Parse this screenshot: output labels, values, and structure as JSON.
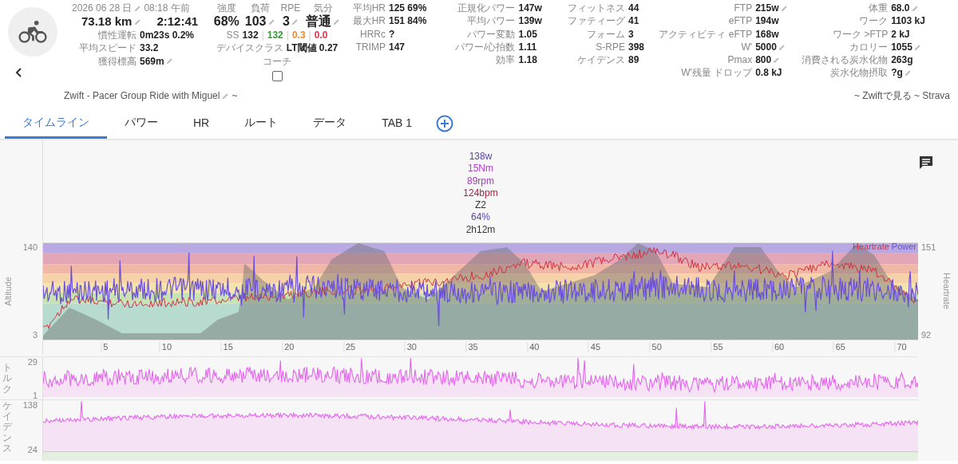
{
  "header": {
    "date": "2026 06 28 日",
    "time": "08:18 午前",
    "distance": "73.18 km",
    "duration": "2:12:41",
    "rows": [
      {
        "label": "慣性運転",
        "value": "0m23s 0.2%",
        "editable": false
      },
      {
        "label": "平均スピード",
        "value": "33.2",
        "editable": false
      },
      {
        "label": "獲得標高",
        "value": "569m",
        "editable": true
      }
    ],
    "ratings": [
      {
        "label": "強度",
        "value": "68%",
        "editable": false
      },
      {
        "label": "負荷",
        "value": "103",
        "editable": true
      },
      {
        "label": "RPE",
        "value": "3",
        "editable": true
      },
      {
        "label": "気分",
        "value": "普通",
        "editable": true
      }
    ],
    "ss": {
      "label": "SS",
      "separator": "|",
      "parts": [
        {
          "text": "132",
          "color": "#222222"
        },
        {
          "text": "132",
          "color": "#3a9a3a"
        },
        {
          "text": "0.3",
          "color": "#f08a24"
        },
        {
          "text": "0.0",
          "color": "#e0304a"
        }
      ]
    },
    "device_class": {
      "label": "デバイスクラス",
      "value": "LT閾値 0.27"
    },
    "coach": {
      "label": "コーチ",
      "checked": false
    },
    "stat_columns": [
      [
        {
          "label": "平均HR",
          "value": "125 69%",
          "editable": false
        },
        {
          "label": "最大HR",
          "value": "151 84%",
          "editable": false
        },
        {
          "label": "HRRc",
          "value": "?",
          "editable": false
        },
        {
          "label": "TRIMP",
          "value": "147",
          "editable": false
        }
      ],
      [
        {
          "label": "正規化パワー",
          "value": "147w",
          "editable": false
        },
        {
          "label": "平均パワー",
          "value": "139w",
          "editable": false
        },
        {
          "label": "パワー変動",
          "value": "1.05",
          "editable": false
        },
        {
          "label": "パワー/心拍数",
          "value": "1.11",
          "editable": false
        },
        {
          "label": "効率",
          "value": "1.18",
          "editable": false
        }
      ],
      [
        {
          "label": "フィットネス",
          "value": "44",
          "editable": false
        },
        {
          "label": "ファティーグ",
          "value": "41",
          "editable": false
        },
        {
          "label": "フォーム",
          "value": "3",
          "editable": false
        },
        {
          "label": "S-RPE",
          "value": "398",
          "editable": false
        },
        {
          "label": "ケイデンス",
          "value": "89",
          "editable": false
        }
      ],
      [
        {
          "label": "FTP",
          "value": "215w",
          "editable": true
        },
        {
          "label": "eFTP",
          "value": "194w",
          "editable": false
        },
        {
          "label": "アクティビティ eFTP",
          "value": "168w",
          "editable": false
        },
        {
          "label": "W'",
          "value": "5000",
          "editable": true
        },
        {
          "label": "Pmax",
          "value": "800",
          "editable": true
        },
        {
          "label": "W'残量 ドロップ",
          "value": "0.8 kJ",
          "editable": false
        }
      ],
      [
        {
          "label": "体重",
          "value": "68.0",
          "editable": true
        },
        {
          "label": "ワーク",
          "value": "1103 kJ",
          "editable": false
        },
        {
          "label": "ワーク >FTP",
          "value": "2 kJ",
          "editable": false
        },
        {
          "label": "カロリー",
          "value": "1055",
          "editable": true
        },
        {
          "label": "消費される炭水化物",
          "value": "263g",
          "editable": false
        },
        {
          "label": "炭水化物摂取",
          "value": "?g",
          "editable": true
        }
      ]
    ]
  },
  "title": {
    "text": "Zwift - Pacer Group Ride with Miguel",
    "suffix": "~"
  },
  "links": "~ Zwiftで見る ~ Strava",
  "tabs": [
    {
      "label": "タイムライン",
      "selected": true
    },
    {
      "label": "パワー",
      "selected": false
    },
    {
      "label": "HR",
      "selected": false
    },
    {
      "label": "ルート",
      "selected": false
    },
    {
      "label": "データ",
      "selected": false
    },
    {
      "label": "TAB 1",
      "selected": false
    }
  ],
  "chart_tooltip": [
    {
      "text": "138w",
      "color": "#5a3fb8"
    },
    {
      "text": "15Nm",
      "color": "#b040c8"
    },
    {
      "text": "89rpm",
      "color": "#a040b8"
    },
    {
      "text": "124bpm",
      "color": "#a02848"
    },
    {
      "text": "Z2",
      "color": "#333333"
    },
    {
      "text": "64%",
      "color": "#5a3fb8"
    },
    {
      "text": "2h12m",
      "color": "#333333"
    }
  ],
  "timeline_chart": {
    "y_left_label": "Altitude",
    "y_left_max": "140",
    "y_left_min": "3",
    "y_right_label": "Heartrate",
    "y_right_max": "151",
    "y_right_min": "92",
    "legend": [
      {
        "name": "Heartrate",
        "color": "#d03040"
      },
      {
        "name": "Power",
        "color": "#6a4fd8"
      }
    ],
    "x_ticks": [
      "5",
      "10",
      "15",
      "20",
      "25",
      "30",
      "35",
      "40",
      "45",
      "50",
      "55",
      "60",
      "65",
      "70"
    ]
  },
  "torque_chart": {
    "label": "トルク",
    "max": "29",
    "min": "1"
  },
  "cadence_chart": {
    "label": "ケイデンス",
    "max": "138",
    "min": "24"
  }
}
